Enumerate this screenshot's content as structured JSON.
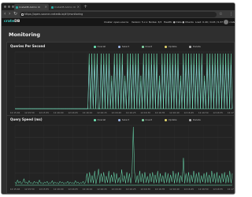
{
  "browser": {
    "tabs": [
      {
        "label": "CrateDB Admin UI"
      },
      {
        "label": "CrateDB Admin UI"
      }
    ],
    "new_tab": "+",
    "address": "https://open-source.cratedb.io/#!/monitoring"
  },
  "app": {
    "logo_prefix": "crate",
    "logo_suffix": "DB",
    "stats": [
      {
        "label": "Cluster: open-source"
      },
      {
        "label": "Version: 5.x.x"
      },
      {
        "label": "Nodes: 3/3"
      },
      {
        "label": "Health: ● Data ● Checks"
      },
      {
        "label": "Load: 0.49 / 0.43 / 0.37"
      }
    ],
    "user": "crate"
  },
  "page": {
    "title": "Monitoring"
  },
  "legend": [
    {
      "label": "Overall",
      "color": "#6ee7b7"
    },
    {
      "label": "Select",
      "color": "#9fb8e8"
    },
    {
      "label": "Insert",
      "color": "#84d9a8"
    },
    {
      "label": "Update",
      "color": "#e6d86e"
    },
    {
      "label": "Delete",
      "color": "#b9b9b9"
    }
  ],
  "chart_data": [
    {
      "type": "line",
      "title": "Queries Per Second",
      "x_ticks": [
        "12:15:46",
        "12:15:50",
        "12:15:55",
        "12:16:00",
        "12:16:05",
        "12:16:10",
        "12:16:15",
        "12:16:20",
        "12:16:25",
        "12:16:30",
        "12:16:35",
        "12:16:40",
        "12:16:45",
        "12:16:50",
        "12:16:55",
        "12:17:00"
      ],
      "series": [
        {
          "name": "Overall",
          "values": [
            0,
            0,
            0,
            0,
            0,
            0,
            0,
            0,
            0,
            0,
            0,
            0,
            0,
            0,
            0,
            0,
            0,
            0,
            0,
            0,
            0,
            0,
            0,
            0,
            0,
            0,
            0,
            0,
            0,
            0,
            0,
            0,
            0,
            0,
            0,
            0,
            0,
            0,
            0,
            0,
            0,
            0,
            0,
            0,
            0,
            0,
            0,
            0,
            0,
            0,
            0,
            0,
            0,
            0,
            0,
            0,
            1,
            0,
            1,
            0,
            1,
            0,
            1,
            0,
            0,
            1,
            0,
            1,
            0,
            1,
            0,
            1,
            0,
            0.6,
            0,
            1,
            0,
            1,
            0,
            1,
            0,
            1,
            0,
            0.6,
            0,
            1,
            0,
            1,
            0,
            1,
            0,
            1,
            0,
            1,
            0,
            0.6,
            0,
            1,
            0,
            1,
            0,
            1,
            0,
            1,
            0,
            1,
            0,
            1,
            0,
            0.6,
            0,
            1,
            0,
            1,
            0,
            1,
            0,
            1,
            0,
            1,
            0,
            1,
            0,
            1,
            0,
            0.6,
            0,
            1,
            0,
            1,
            0,
            1,
            0,
            1,
            0,
            1,
            0,
            1,
            0,
            1,
            0,
            1,
            0,
            0.6,
            0,
            1,
            0,
            1,
            0,
            1,
            0,
            1,
            0,
            1,
            0,
            1,
            0,
            1,
            0,
            1,
            0,
            1,
            0,
            1,
            0
          ]
        },
        {
          "name": "Select",
          "values": [
            0,
            0,
            0,
            0,
            0,
            0,
            0,
            0,
            0,
            0,
            0,
            0,
            0,
            0,
            0,
            0,
            0,
            0,
            0,
            0,
            0,
            0,
            0,
            0,
            0,
            0,
            0,
            0,
            0,
            0,
            0,
            0,
            0,
            0,
            0,
            0,
            0,
            0,
            0,
            0,
            0,
            0,
            0,
            0,
            0,
            0,
            0,
            0,
            0,
            0,
            0,
            0,
            0,
            0,
            0,
            0,
            0.8,
            0,
            0.8,
            0,
            0.8,
            0,
            0.8,
            0,
            0,
            0.8,
            0,
            0.8,
            0,
            0.8,
            0,
            0.8,
            0,
            0.5,
            0,
            0.8,
            0,
            0.8,
            0,
            0.8,
            0,
            0.8,
            0,
            0.5,
            0,
            0.8,
            0,
            0.8,
            0,
            0.8,
            0,
            0.8,
            0,
            0.8,
            0,
            0.5,
            0,
            0.8,
            0,
            0.8,
            0,
            0.8,
            0,
            0.8,
            0,
            0.8,
            0,
            0.8,
            0,
            0.5,
            0,
            0.8,
            0,
            0.8,
            0,
            0.8,
            0,
            0.8,
            0,
            0.8,
            0,
            0.8,
            0,
            0.8,
            0,
            0.5,
            0,
            0.8,
            0,
            0.8,
            0,
            0.8,
            0,
            0.8,
            0,
            0.8,
            0,
            0.8,
            0,
            0.8,
            0,
            0.8,
            0,
            0.5,
            0,
            0.8,
            0,
            0.8,
            0,
            0.8,
            0,
            0.8,
            0,
            0.8,
            0,
            0.8,
            0,
            0.8,
            0,
            0.8,
            0,
            0.8,
            0,
            0.8,
            0
          ]
        }
      ]
    },
    {
      "type": "line",
      "title": "Query Speed (ms)",
      "x_ticks": [
        "12:15:46",
        "12:15:50",
        "12:15:55",
        "12:16:00",
        "12:16:05",
        "12:16:10",
        "12:16:15",
        "12:16:20",
        "12:16:25",
        "12:16:30",
        "12:16:35",
        "12:16:40",
        "12:16:45",
        "12:16:50",
        "12:16:55",
        "12:17:00"
      ],
      "series": [
        {
          "name": "Overall",
          "values": [
            0.05,
            0.02,
            0.08,
            0.03,
            0.06,
            0.02,
            0.04,
            0.1,
            0.03,
            0.05,
            0.02,
            0.07,
            0.03,
            0.04,
            0.02,
            0.06,
            0.03,
            0.05,
            0.02,
            0.08,
            0.03,
            0.04,
            0.02,
            0.05,
            0.03,
            0.06,
            0.02,
            0.04,
            0.03,
            0.07,
            0.02,
            0.05,
            0.03,
            0.04,
            0.02,
            0.06,
            0.03,
            0.05,
            0.02,
            0.04,
            0.03,
            0.06,
            0.02,
            0.05,
            0.03,
            0.04,
            0.02,
            0.07,
            0.03,
            0.05,
            0.02,
            0.04,
            0.03,
            0.06,
            0.02,
            0.05,
            0.18,
            0.03,
            0.2,
            0.04,
            0.15,
            0.03,
            0.22,
            0.02,
            0.12,
            0.25,
            0.03,
            0.18,
            0.05,
            0.2,
            0.03,
            0.14,
            0.04,
            0.22,
            0.03,
            0.16,
            0.05,
            0.2,
            0.03,
            0.18,
            0.04,
            0.12,
            0.03,
            0.24,
            0.05,
            0.15,
            0.03,
            0.2,
            0.04,
            0.18,
            0.03,
            0.16,
            0.9,
            0.2,
            0.04,
            0.15,
            0.03,
            0.22,
            0.05,
            0.18,
            0.03,
            0.2,
            0.04,
            0.14,
            0.03,
            0.18,
            0.05,
            0.2,
            0.03,
            0.16,
            0.04,
            0.22,
            0.03,
            0.18,
            0.05,
            0.15,
            0.03,
            0.2,
            0.04,
            0.18,
            0.03,
            0.16,
            0.05,
            0.22,
            0.03,
            0.18,
            0.04,
            0.2,
            0.03,
            0.15,
            0.05,
            0.42,
            0.03,
            0.18,
            0.04,
            0.2,
            0.03,
            0.16,
            0.05,
            0.22,
            0.03,
            0.18,
            0.04,
            0.2,
            0.03,
            0.15,
            0.05,
            0.18,
            0.03,
            0.2,
            0.04,
            0.16,
            0.03,
            0.22,
            0.05,
            0.18,
            0.03,
            0.2,
            0.04,
            0.15,
            0.03,
            0.18,
            0.05,
            0.2,
            0.03,
            0.16,
            0.04,
            0.22,
            0.03,
            0.18
          ]
        }
      ]
    }
  ]
}
